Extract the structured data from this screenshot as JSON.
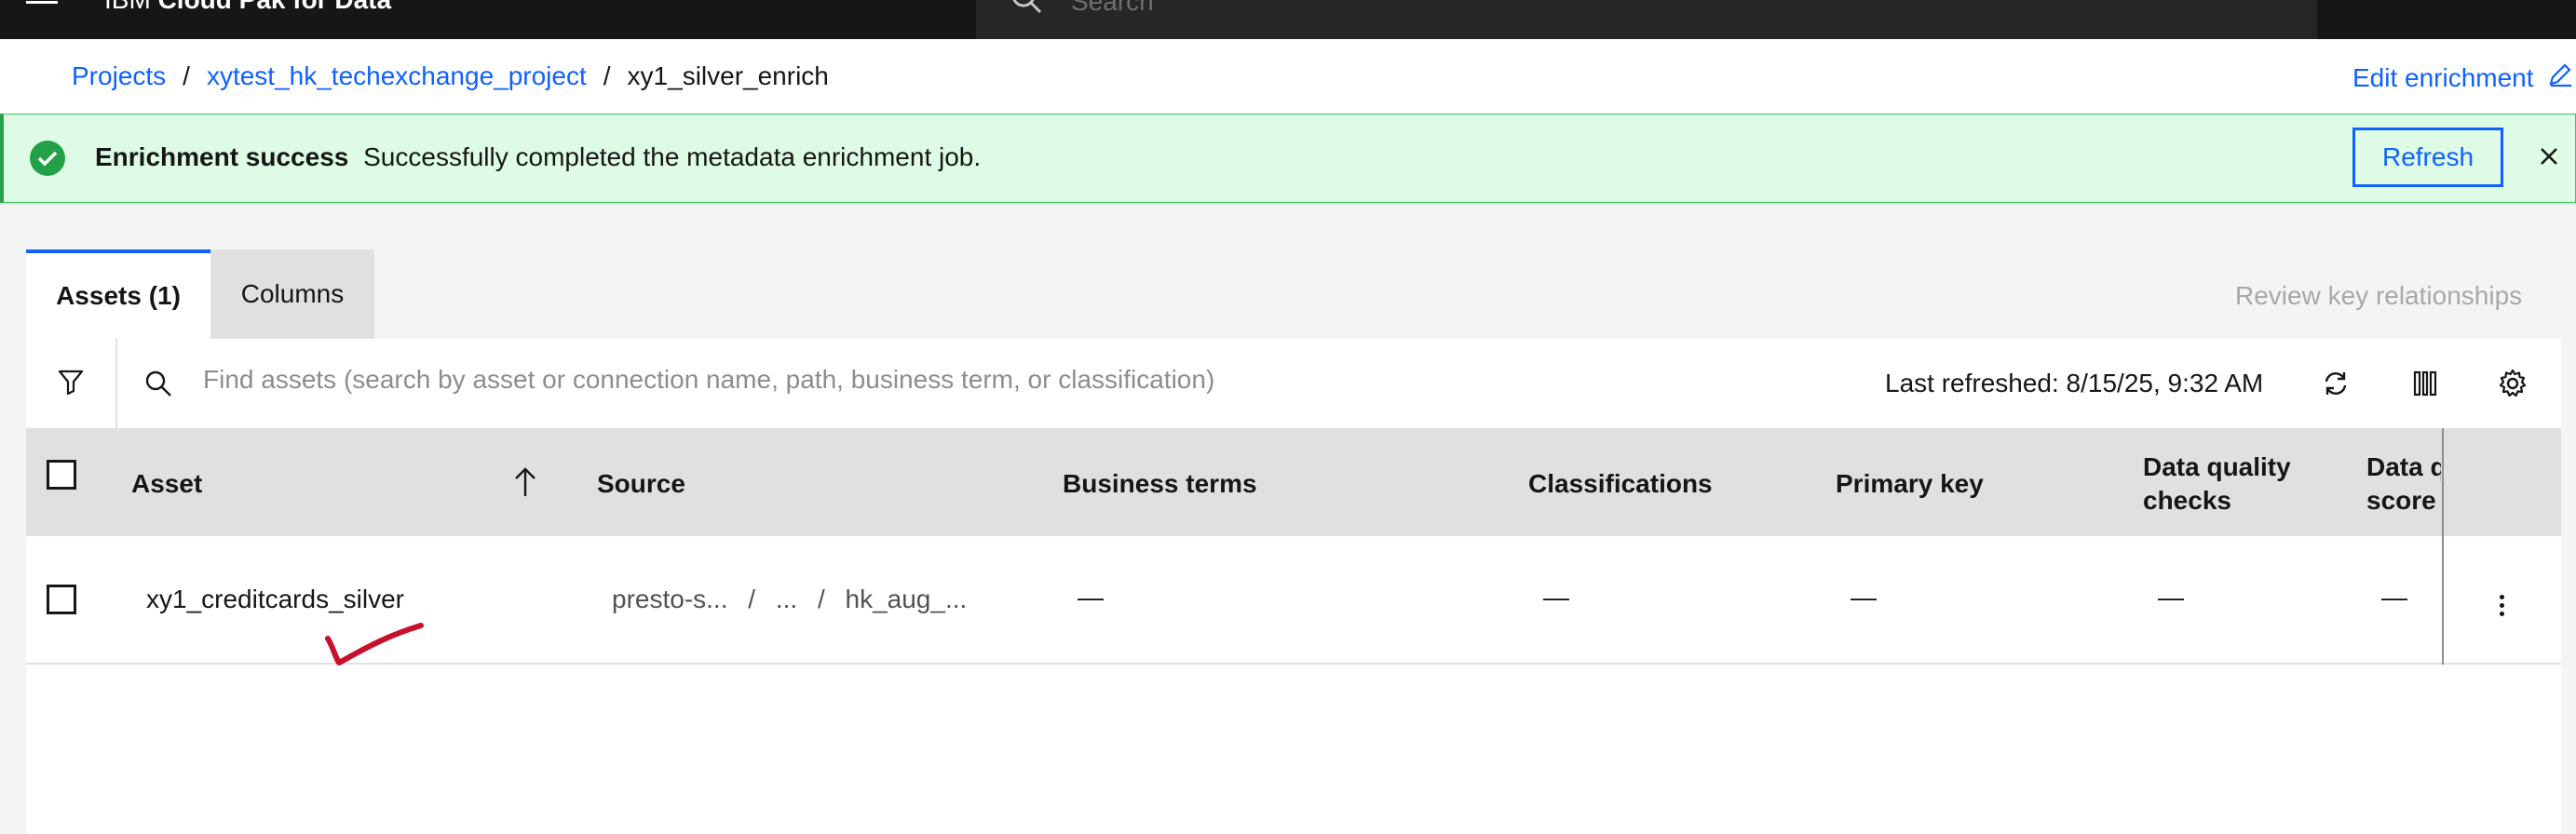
{
  "header": {
    "brand_prefix": "IBM",
    "brand_name": "Cloud Pak for Data",
    "search_placeholder": "Search"
  },
  "breadcrumb": {
    "items": [
      "Projects",
      "xytest_hk_techexchange_project",
      "xy1_silver_enrich"
    ],
    "separator": "/",
    "edit_label": "Edit enrichment"
  },
  "notification": {
    "title": "Enrichment success",
    "message": "Successfully completed the metadata enrichment job.",
    "refresh_label": "Refresh"
  },
  "tabs": [
    {
      "label": "Assets (1)",
      "active": true
    },
    {
      "label": "Columns",
      "active": false
    }
  ],
  "review_link": "Review key relationships",
  "toolbar": {
    "search_placeholder": "Find assets (search by asset or connection name, path, business term, or classification)",
    "last_refreshed": "Last refreshed: 8/15/25, 9:32 AM"
  },
  "table": {
    "columns": [
      {
        "label": "Asset"
      },
      {
        "label": "Source"
      },
      {
        "label": "Business terms"
      },
      {
        "label": "Classifications"
      },
      {
        "label": "Primary key"
      },
      {
        "label": "Data quality checks",
        "line1": "Data quality",
        "line2": "checks"
      },
      {
        "label": "Data quality score",
        "line1": "Data q",
        "line2": "score"
      }
    ],
    "rows": [
      {
        "asset": "xy1_creditcards_silver",
        "source": {
          "part1": "presto-s...",
          "sep": "/",
          "ellipsis": "...",
          "part2": "hk_aug_..."
        },
        "business_terms": "—",
        "classifications": "—",
        "primary_key": "—",
        "dq_checks": "—",
        "dq_score": "—"
      }
    ]
  },
  "colors": {
    "accent": "#0f62fe",
    "success": "#24a148",
    "success_bg": "#defbe6",
    "annotation": "#c8102e"
  }
}
